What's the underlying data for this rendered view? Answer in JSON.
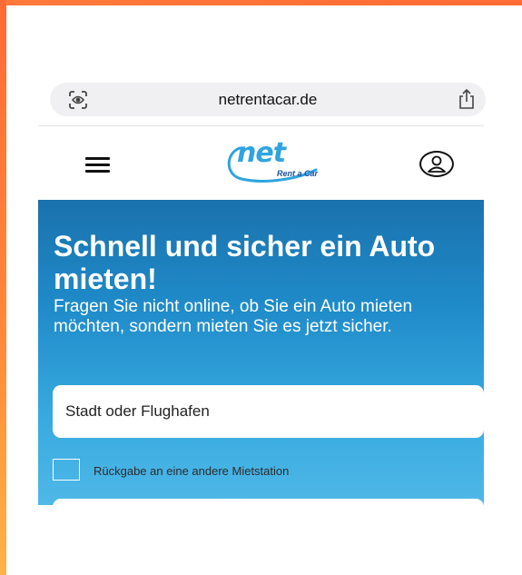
{
  "browser": {
    "url": "netrentacar.de",
    "scan_icon": "camera-scan-icon",
    "share_icon": "share-icon"
  },
  "header": {
    "menu_icon": "hamburger-menu-icon",
    "logo": {
      "word": "net",
      "subtitle": "Rent a Car"
    },
    "user_icon": "user-account-icon"
  },
  "hero": {
    "title": "Schnell und sicher ein Auto mieten!",
    "text": "Fragen Sie nicht online, ob Sie ein Auto mieten möchten, sondern mieten Sie es jetzt sicher.",
    "city_placeholder": "Stadt oder Flughafen",
    "return_checkbox_label": "Rückgabe an eine andere Mietstation",
    "return_checked": false
  },
  "colors": {
    "frame": "#ff6b35",
    "hero_top": "#1a72ad",
    "hero_bottom": "#4fb8e8",
    "logo": "#2fa4e0"
  }
}
